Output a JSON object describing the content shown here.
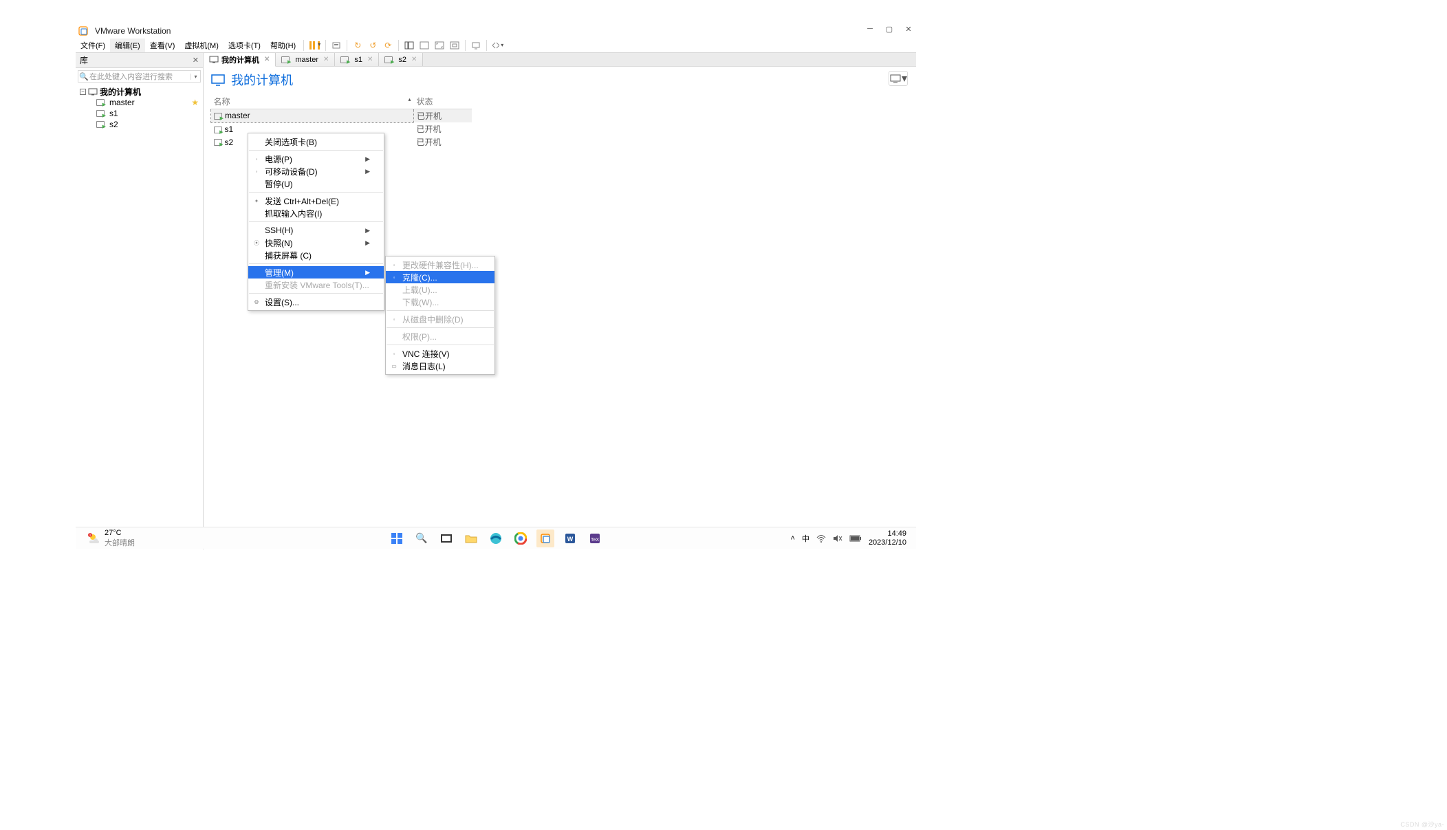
{
  "app": {
    "title": "VMware Workstation"
  },
  "menu": {
    "file": "文件(F)",
    "edit": "编辑(E)",
    "view": "查看(V)",
    "vm": "虚拟机(M)",
    "tabs": "选项卡(T)",
    "help": "帮助(H)"
  },
  "library": {
    "title": "库",
    "search_placeholder": "在此处键入内容进行搜索",
    "root": "我的计算机",
    "items": [
      "master",
      "s1",
      "s2"
    ]
  },
  "tabs_open": [
    {
      "label": "我的计算机",
      "active": true
    },
    {
      "label": "master",
      "active": false
    },
    {
      "label": "s1",
      "active": false
    },
    {
      "label": "s2",
      "active": false
    }
  ],
  "content": {
    "title": "我的计算机",
    "columns": {
      "name": "名称",
      "status": "状态"
    },
    "rows": [
      {
        "name": "master",
        "status": "已开机",
        "selected": true
      },
      {
        "name": "s1",
        "status": "已开机",
        "selected": false
      },
      {
        "name": "s2",
        "status": "已开机",
        "selected": false
      }
    ]
  },
  "ctx1": {
    "close_tab": "关闭选项卡(B)",
    "power": "电源(P)",
    "removable": "可移动设备(D)",
    "pause": "暂停(U)",
    "send_cad": "发送 Ctrl+Alt+Del(E)",
    "grab_input": "抓取输入内容(I)",
    "ssh": "SSH(H)",
    "snapshot": "快照(N)",
    "capture": "捕获屏幕 (C)",
    "manage": "管理(M)",
    "reinstall": "重新安装 VMware Tools(T)...",
    "settings": "设置(S)..."
  },
  "ctx2": {
    "hw_compat": "更改硬件兼容性(H)...",
    "clone": "克隆(C)...",
    "upload": "上载(U)...",
    "download": "下载(W)...",
    "delete_disk": "从磁盘中删除(D)",
    "permissions": "权限(P)...",
    "vnc": "VNC 连接(V)",
    "msg_log": "消息日志(L)"
  },
  "taskbar": {
    "temp": "27°C",
    "weather": "大部晴朗",
    "lang": "中",
    "time": "14:49",
    "date": "2023/12/10"
  },
  "watermark": "CSDN @沙ya-"
}
